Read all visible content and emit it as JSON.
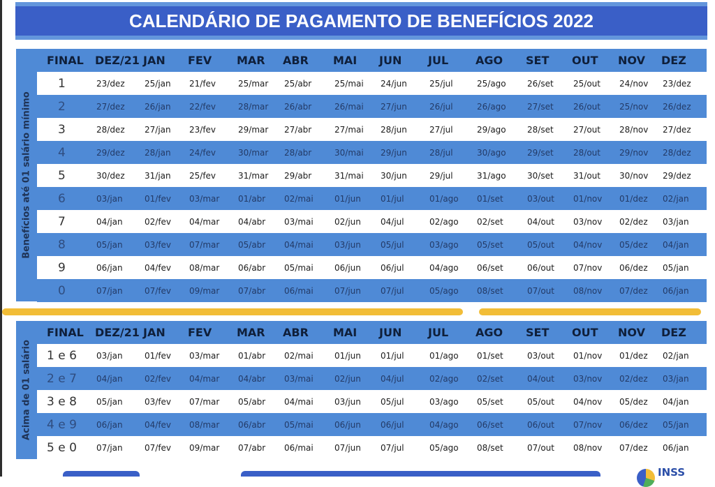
{
  "title": "CALENDÁRIO DE PAGAMENTO DE BENEFÍCIOS 2022",
  "colors": {
    "header_blue": "#3a5fc7",
    "row_blue": "#4f8ad6",
    "separator_yellow": "#f2bd37"
  },
  "table1": {
    "side_label": "Benefícios até 01 salário mínimo",
    "headers": [
      "FINAL",
      "DEZ/21",
      "JAN",
      "FEV",
      "MAR",
      "ABR",
      "MAI",
      "JUN",
      "JUL",
      "AGO",
      "SET",
      "OUT",
      "NOV",
      "DEZ"
    ],
    "rows": [
      [
        "1",
        "23/dez",
        "25/jan",
        "21/fev",
        "25/mar",
        "25/abr",
        "25/mai",
        "24/jun",
        "25/jul",
        "25/ago",
        "26/set",
        "25/out",
        "24/nov",
        "23/dez"
      ],
      [
        "2",
        "27/dez",
        "26/jan",
        "22/fev",
        "28/mar",
        "26/abr",
        "26/mai",
        "27/jun",
        "26/jul",
        "26/ago",
        "27/set",
        "26/out",
        "25/nov",
        "26/dez"
      ],
      [
        "3",
        "28/dez",
        "27/jan",
        "23/fev",
        "29/mar",
        "27/abr",
        "27/mai",
        "28/jun",
        "27/jul",
        "29/ago",
        "28/set",
        "27/out",
        "28/nov",
        "27/dez"
      ],
      [
        "4",
        "29/dez",
        "28/jan",
        "24/fev",
        "30/mar",
        "28/abr",
        "30/mai",
        "29/jun",
        "28/jul",
        "30/ago",
        "29/set",
        "28/out",
        "29/nov",
        "28/dez"
      ],
      [
        "5",
        "30/dez",
        "31/jan",
        "25/fev",
        "31/mar",
        "29/abr",
        "31/mai",
        "30/jun",
        "29/jul",
        "31/ago",
        "30/set",
        "31/out",
        "30/nov",
        "29/dez"
      ],
      [
        "6",
        "03/jan",
        "01/fev",
        "03/mar",
        "01/abr",
        "02/mai",
        "01/jun",
        "01/jul",
        "01/ago",
        "01/set",
        "03/out",
        "01/nov",
        "01/dez",
        "02/jan"
      ],
      [
        "7",
        "04/jan",
        "02/fev",
        "04/mar",
        "04/abr",
        "03/mai",
        "02/jun",
        "04/jul",
        "02/ago",
        "02/set",
        "04/out",
        "03/nov",
        "02/dez",
        "03/jan"
      ],
      [
        "8",
        "05/jan",
        "03/fev",
        "07/mar",
        "05/abr",
        "04/mai",
        "03/jun",
        "05/jul",
        "03/ago",
        "05/set",
        "05/out",
        "04/nov",
        "05/dez",
        "04/jan"
      ],
      [
        "9",
        "06/jan",
        "04/fev",
        "08/mar",
        "06/abr",
        "05/mai",
        "06/jun",
        "06/jul",
        "04/ago",
        "06/set",
        "06/out",
        "07/nov",
        "06/dez",
        "05/jan"
      ],
      [
        "0",
        "07/jan",
        "07/fev",
        "09/mar",
        "07/abr",
        "06/mai",
        "07/jun",
        "07/jul",
        "05/ago",
        "08/set",
        "07/out",
        "08/nov",
        "07/dez",
        "06/jan"
      ]
    ]
  },
  "table2": {
    "side_label": "Acima de 01 salário",
    "headers": [
      "FINAL",
      "DEZ/21",
      "JAN",
      "FEV",
      "MAR",
      "ABR",
      "MAI",
      "JUN",
      "JUL",
      "AGO",
      "SET",
      "OUT",
      "NOV",
      "DEZ"
    ],
    "rows": [
      [
        "1 e 6",
        "03/jan",
        "01/fev",
        "03/mar",
        "01/abr",
        "02/mai",
        "01/jun",
        "01/jul",
        "01/ago",
        "01/set",
        "03/out",
        "01/nov",
        "01/dez",
        "02/jan"
      ],
      [
        "2 e 7",
        "04/jan",
        "02/fev",
        "04/mar",
        "04/abr",
        "03/mai",
        "02/jun",
        "04/jul",
        "02/ago",
        "02/set",
        "04/out",
        "03/nov",
        "02/dez",
        "03/jan"
      ],
      [
        "3 e 8",
        "05/jan",
        "03/fev",
        "07/mar",
        "05/abr",
        "04/mai",
        "03/jun",
        "05/jul",
        "03/ago",
        "05/set",
        "05/out",
        "04/nov",
        "05/dez",
        "04/jan"
      ],
      [
        "4 e 9",
        "06/jan",
        "04/fev",
        "08/mar",
        "06/abr",
        "05/mai",
        "06/jun",
        "06/jul",
        "04/ago",
        "06/set",
        "06/out",
        "07/nov",
        "06/dez",
        "05/jan"
      ],
      [
        "5 e 0",
        "07/jan",
        "07/fev",
        "09/mar",
        "07/abr",
        "06/mai",
        "07/jun",
        "07/jul",
        "05/ago",
        "08/set",
        "07/out",
        "08/nov",
        "07/dez",
        "06/jan"
      ]
    ]
  },
  "logo": {
    "text": "INSS"
  }
}
